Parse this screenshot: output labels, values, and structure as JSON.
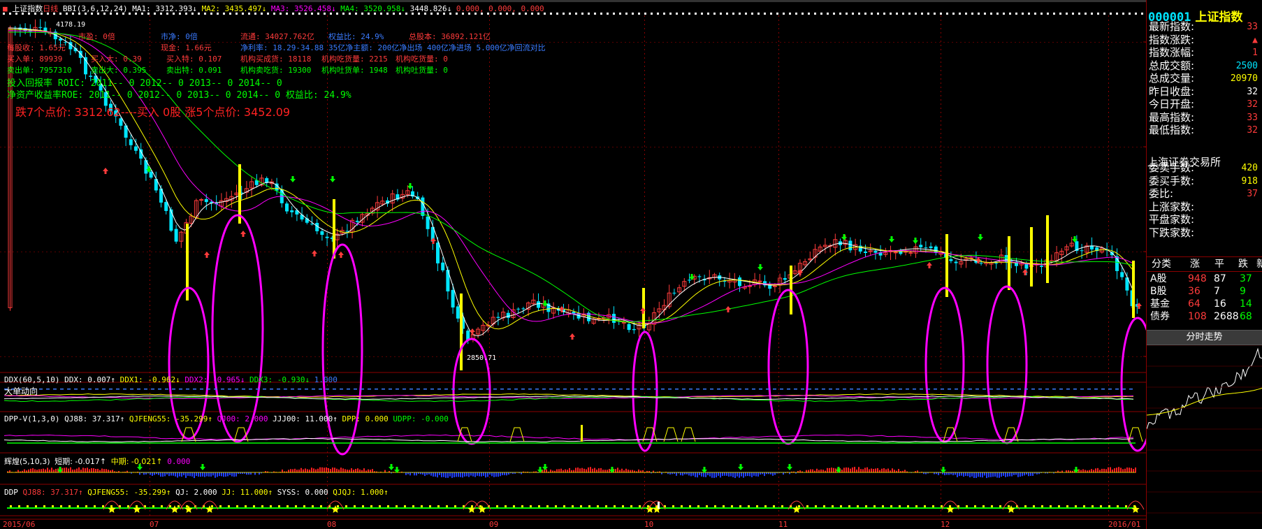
{
  "header": {
    "index_name": "上证指数",
    "period": "日线",
    "bbi_label": "BBI(3,6,12,24)",
    "ma1": "MA1: 3312.393↓",
    "ma2": "MA2: 3435.497↓",
    "ma3": "MA3: 3526.458↓",
    "ma4": "MA4: 3520.958↓",
    "extra1": "3448.826↓",
    "extra2": "0.000, 0.000, 0.000"
  },
  "fundamentals": {
    "row1": [
      "市盈: 0倍",
      "市净: 0倍",
      "流通: 34027.762亿",
      "权益比: 24.9%",
      "总股本: 36892.121亿"
    ],
    "row2": [
      "每股收: 1.65元",
      "现金: 1.66元",
      "净利率: 18.29-34.88",
      "35亿净主额: 200亿净出场 400亿净进场 5.000亿净回流对比"
    ],
    "row3": [
      "买入单: 89939",
      "买入大: 0.39",
      "买入特: 0.107",
      "机构买成货: 18118",
      "机构吃货量: 2215",
      "机构吃货量: 0"
    ],
    "row4": [
      "卖出单: 7957310",
      "卖出大: 0.395",
      "卖出特: 0.091",
      "机构卖吃货: 19300",
      "机构吐货单: 1948",
      "机构吐货量: 0"
    ],
    "roe1": "投入回报率 ROIC: 2011-- 0   2012-- 0   2013-- 0   2014-- 0",
    "roe2": "净资产收益率ROE: 2011-- 0   2012-- 0   2013-- 0   2014-- 0   权益比: 24.9%",
    "signal": "跌7个点价: 3312.62----买入 0股   涨5个点价: 3452.09"
  },
  "price_labels": {
    "high": "4178.19",
    "low": "2850.71"
  },
  "indicators": {
    "ddx": {
      "name": "DDX(60,5,10)",
      "ddx": "DDX: 0.007↑",
      "ddx1": "DDX1: -0.962↓",
      "ddx2": "DDX2: -0.965↓",
      "ddx3": "DDX3: -0.930↓",
      "extra": "1.000",
      "sub": "大单动向"
    },
    "dpp": {
      "name": "DPP-V(1,3,0)",
      "qj88": "QJ88: 37.317↑",
      "qjfeng": "QJFENG55: -35.299↑",
      "qj00": "QJ00: 2.000",
      "jjj00": "JJJ00: 11.000↑",
      "dpp": "DPP: 0.000",
      "udpp": "UDPP: -0.000"
    },
    "hh": {
      "name": "辉煌(5,10,3)",
      "short": "短期: -0.017↑",
      "mid": "中期: -0.021↑",
      "extra": "0.000"
    },
    "ddp": {
      "name": "DDP",
      "qj88": "QJ88: 37.317↑",
      "qjfeng": "QJFENG55: -35.299↑",
      "qj": "QJ: 2.000",
      "jj": "JJ: 11.000↑",
      "syss": "SYSS: 0.000",
      "qjqj": "QJQJ: 1.000↑"
    }
  },
  "time_axis": [
    "2015/06",
    "07",
    "08",
    "09",
    "10",
    "11",
    "12",
    "2016/01"
  ],
  "quote": {
    "code": "000001",
    "name": "上证指数",
    "rows": [
      {
        "label": "最新指数:",
        "value": "33",
        "color": "#ff3b3b"
      },
      {
        "label": "指数涨跌:",
        "value": "▲",
        "color": "#ff3b3b"
      },
      {
        "label": "指数涨幅:",
        "value": "1",
        "color": "#ff3b3b"
      },
      {
        "label": "总成交额:",
        "value": "2500",
        "color": "#00e5ff"
      },
      {
        "label": "总成交量:",
        "value": "20970",
        "color": "#ffff00"
      },
      {
        "label": "昨日收盘:",
        "value": "32",
        "color": "#ffffff"
      },
      {
        "label": "今日开盘:",
        "value": "32",
        "color": "#ff3b3b"
      },
      {
        "label": "最高指数:",
        "value": "33",
        "color": "#ff3b3b"
      },
      {
        "label": "最低指数:",
        "value": "32",
        "color": "#ff3b3b"
      }
    ],
    "exchange": "上海证券交易所",
    "rows2": [
      {
        "label": "委卖手数:",
        "value": "420",
        "color": "#ffff00"
      },
      {
        "label": "委买手数:",
        "value": "918",
        "color": "#ffff00"
      },
      {
        "label": "委比:",
        "value": "37",
        "color": "#ff3b3b"
      },
      {
        "label": "上涨家数:",
        "value": "",
        "color": "#ff3b3b"
      },
      {
        "label": "平盘家数:",
        "value": "",
        "color": "#ffffff"
      },
      {
        "label": "下跌家数:",
        "value": "",
        "color": "#00ff00"
      }
    ],
    "table_header": [
      "分类",
      "涨",
      "平",
      "跌",
      "新"
    ],
    "table_rows": [
      {
        "cat": "A股",
        "up": "948",
        "flat": "87",
        "down": "37"
      },
      {
        "cat": "B股",
        "up": "36",
        "flat": "7",
        "down": "9"
      },
      {
        "cat": "基金",
        "up": "64",
        "flat": "16",
        "down": "14"
      },
      {
        "cat": "债券",
        "up": "108",
        "flat": "2688",
        "down": "68"
      }
    ],
    "intraday_button": "分时走势"
  },
  "colors": {
    "up": "#ff3b3b",
    "down": "#00e5ff",
    "grid": "#8b0000",
    "ellipse": "#ff00ff",
    "yellow_bar": "#ffff00"
  }
}
